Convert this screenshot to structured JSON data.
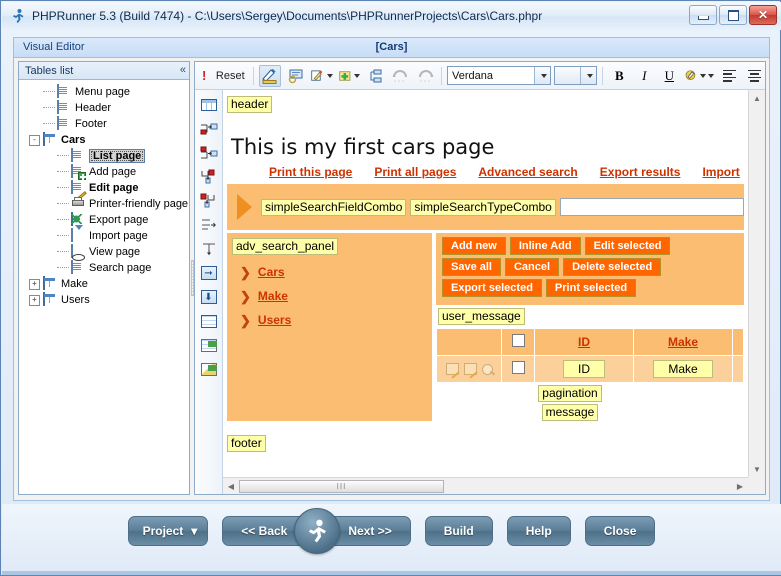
{
  "window": {
    "title": "PHPRunner 5.3 (Build 7474) - C:\\Users\\Sergey\\Documents\\PHPRunnerProjects\\Cars\\Cars.phpr",
    "app_icon": "runner-icon",
    "minimize_label": "–",
    "maximize_label": "▭",
    "close_label": "✕"
  },
  "tabstrip": {
    "left_label": "Visual Editor",
    "center_label": "[Cars]"
  },
  "tables_panel": {
    "header": "Tables list",
    "collapse_icon": "«",
    "tree": [
      {
        "label": "Menu page",
        "indent": 1,
        "icon": "page-icon",
        "expander": "",
        "bold": false,
        "selected": false
      },
      {
        "label": "Header",
        "indent": 1,
        "icon": "page-icon",
        "expander": "",
        "bold": false,
        "selected": false
      },
      {
        "label": "Footer",
        "indent": 1,
        "icon": "page-icon",
        "expander": "",
        "bold": false,
        "selected": false
      },
      {
        "label": "Cars",
        "indent": 0,
        "icon": "table-icon",
        "expander": "-",
        "bold": true,
        "selected": false
      },
      {
        "label": "List page",
        "indent": 2,
        "icon": "page-icon",
        "expander": "",
        "bold": true,
        "selected": true
      },
      {
        "label": "Add page",
        "indent": 2,
        "icon": "add-page-icon",
        "expander": "",
        "bold": false,
        "selected": false
      },
      {
        "label": "Edit page",
        "indent": 2,
        "icon": "edit-page-icon",
        "expander": "",
        "bold": true,
        "selected": false
      },
      {
        "label": "Printer-friendly page",
        "indent": 2,
        "icon": "printer-icon",
        "expander": "",
        "bold": false,
        "selected": false
      },
      {
        "label": "Export page",
        "indent": 2,
        "icon": "export-icon",
        "expander": "",
        "bold": false,
        "selected": false
      },
      {
        "label": "Import page",
        "indent": 2,
        "icon": "import-icon",
        "expander": "",
        "bold": false,
        "selected": false
      },
      {
        "label": "View page",
        "indent": 2,
        "icon": "view-icon",
        "expander": "",
        "bold": false,
        "selected": false
      },
      {
        "label": "Search page",
        "indent": 2,
        "icon": "page-icon",
        "expander": "",
        "bold": false,
        "selected": false
      },
      {
        "label": "Make",
        "indent": 0,
        "icon": "table-icon",
        "expander": "+",
        "bold": false,
        "selected": false
      },
      {
        "label": "Users",
        "indent": 0,
        "icon": "table-icon",
        "expander": "+",
        "bold": false,
        "selected": false
      }
    ]
  },
  "toolbar": {
    "alert_icon": "exclamation-icon",
    "reset_label": "Reset",
    "items": [
      {
        "name": "design-mode-icon",
        "pressed": true
      },
      {
        "name": "properties-icon",
        "pressed": false
      },
      {
        "name": "edit-icon",
        "pressed": false,
        "dropdown": true
      },
      {
        "name": "insert-icon",
        "pressed": false,
        "dropdown": true
      },
      {
        "name": "structure-icon",
        "pressed": false
      },
      {
        "name": "undo-icon",
        "pressed": false
      },
      {
        "name": "redo-icon",
        "pressed": false
      }
    ],
    "font_value": "Verdana",
    "font_size_value": "",
    "bold_label": "B",
    "italic_label": "I",
    "underline_label": "U",
    "color_icon": "text-color-icon",
    "align_left_icon": "align-left-icon",
    "align_center_icon": "align-center-icon"
  },
  "vtoolbar": {
    "items": [
      "insert-table-icon",
      "insert-column-right-icon",
      "insert-column-left-icon",
      "insert-row-below-icon",
      "insert-row-above-icon",
      "merge-cells-icon",
      "split-cells-icon",
      "move-right-icon",
      "move-down-icon",
      "grid-properties-icon",
      "table-image-icon",
      "insert-image-icon"
    ]
  },
  "canvas": {
    "header_tag": "header",
    "page_title": "This is my first cars page",
    "nav_links": [
      "Print this page",
      "Print all pages",
      "Advanced search",
      "Export results",
      "Import"
    ],
    "search": {
      "field_combo": "simpleSearchFieldCombo",
      "type_combo": "simpleSearchTypeCombo",
      "input_value": "",
      "input_placeholder": ""
    },
    "adv_panel": {
      "tag": "adv_search_panel",
      "links": [
        "Cars",
        "Make",
        "Users"
      ]
    },
    "buttons": [
      [
        "Add new",
        "Inline Add",
        "Edit selected"
      ],
      [
        "Save all",
        "Cancel",
        "Delete selected"
      ],
      [
        "Export selected",
        "Print selected"
      ]
    ],
    "user_message_tag": "user_message",
    "grid": {
      "headers": [
        "",
        "",
        "ID",
        "Make",
        ""
      ],
      "row_icons": [
        "edit-row-icon",
        "inline-edit-row-icon",
        "view-row-icon"
      ],
      "cells": [
        "ID",
        "Make"
      ]
    },
    "pagination_tag": "pagination",
    "message_tag": "message",
    "footer_tag": "footer"
  },
  "scrollbars": {
    "up_arrow": "▲",
    "down_arrow": "▼",
    "left_arrow": "◀",
    "right_arrow": "▶",
    "thumb_grip": "III"
  },
  "bottom_buttons": {
    "project": "Project",
    "project_caret": "▾",
    "back": "<< Back",
    "next": "Next >>",
    "build": "Build",
    "help": "Help",
    "close": "Close",
    "runner_icon": "runner-icon"
  },
  "colors": {
    "panel_orange": "#fbbd72",
    "button_orange": "#ff6600",
    "link_red": "#cc3300",
    "tag_yellow": "#ffffaa",
    "cell_orange": "#fcd09b",
    "steel_blue": "#5b7e97",
    "close_red": "#d9534a"
  }
}
